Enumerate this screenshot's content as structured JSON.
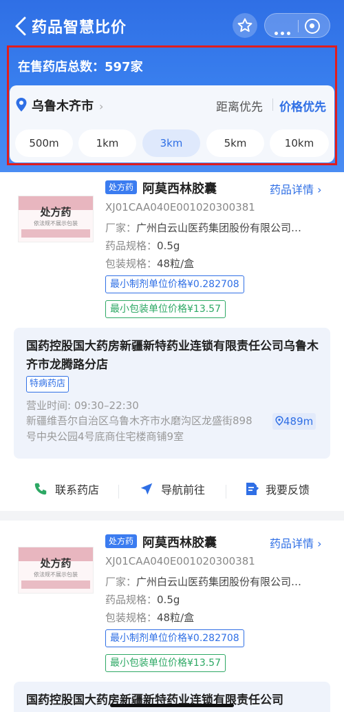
{
  "header": {
    "title": "药品智慧比价",
    "total_stores": "在售药店总数：597家",
    "city": "乌鲁木齐市",
    "sort_distance": "距离优先",
    "sort_price": "价格优先",
    "radius_options": [
      "500m",
      "1km",
      "3km",
      "5km",
      "10km"
    ],
    "selected_radius": "3km",
    "accent_color": "#2f6fe5",
    "highlight_color": "#e11d1d"
  },
  "listings": [
    {
      "image_text": "处方药",
      "image_title": "阿莫西林胶囊",
      "image_note": "依法规不展示包装",
      "rx_badge": "处方药",
      "name": "阿莫西林胶囊",
      "detail_link": "药品详情",
      "code": "XJ01CAA040E001020300381",
      "manufacturer_label": "厂家：",
      "manufacturer": "广州白云山医药集团股份有限公司…",
      "spec_label": "药品规格：",
      "spec": "0.5g",
      "pack_label": "包装规格：",
      "pack": "48粒/盒",
      "min_unit_price": "最小制剂单位价格¥0.282708",
      "min_pack_price": "最小包装单位价格¥13.57",
      "store": {
        "name": "国药控股国大药房新疆新特药业连锁有限责任公司乌鲁木齐市龙腾路分店",
        "tag": "特病药店",
        "hours": "营业时间: 09:30–22:30",
        "address": "新疆维吾尔自治区乌鲁木齐市水磨沟区龙盛街898号中央公园4号底商住宅楼商铺9室",
        "distance": "489m"
      },
      "actions": {
        "contact": "联系药店",
        "navigate": "导航前往",
        "feedback": "我要反馈"
      }
    },
    {
      "image_text": "处方药",
      "image_title": "阿莫西林胶囊",
      "image_note": "依法规不展示包装",
      "rx_badge": "处方药",
      "name": "阿莫西林胶囊",
      "detail_link": "药品详情",
      "code": "XJ01CAA040E001020300381",
      "manufacturer_label": "厂家：",
      "manufacturer": "广州白云山医药集团股份有限公司…",
      "spec_label": "药品规格：",
      "spec": "0.5g",
      "pack_label": "包装规格：",
      "pack": "48粒/盒",
      "min_unit_price": "最小制剂单位价格¥0.282708",
      "min_pack_price": "最小包装单位价格¥13.57",
      "store": {
        "name": "国药控股国大药房新疆新特药业连锁有限责任公司"
      }
    }
  ]
}
